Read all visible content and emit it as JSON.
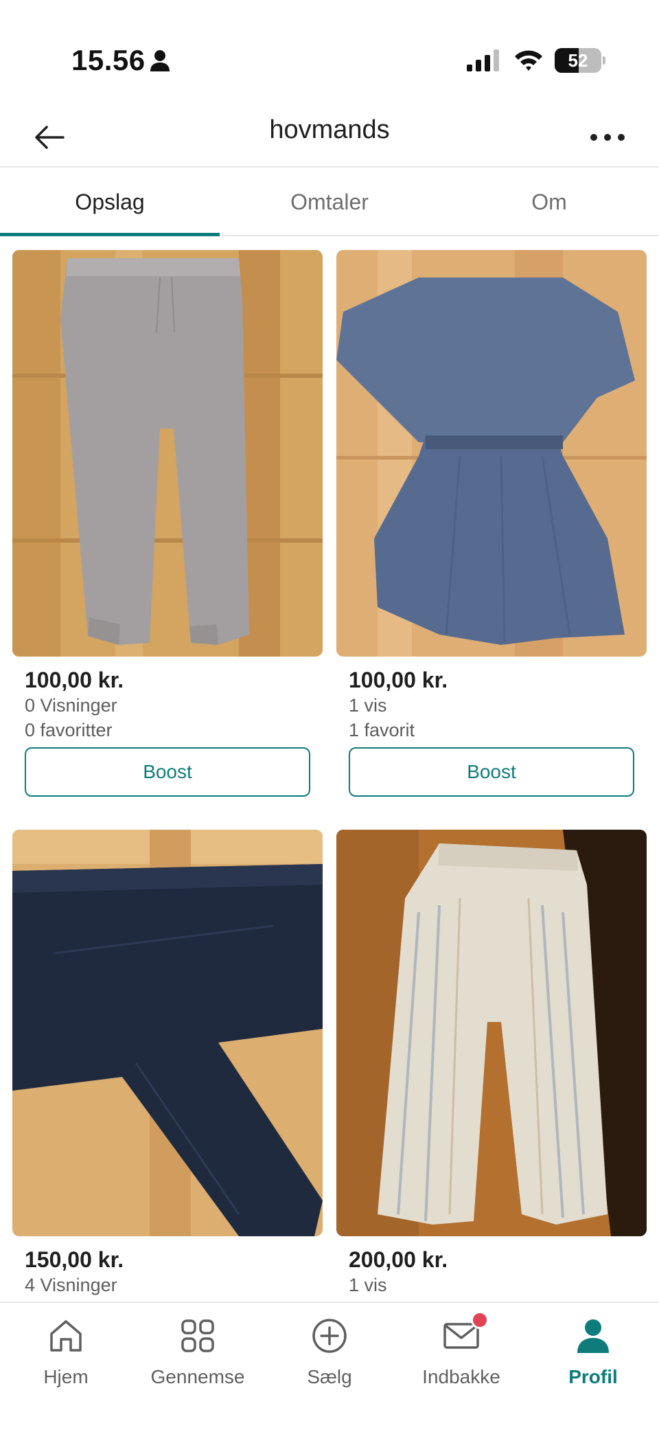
{
  "status_bar": {
    "time": "15.56",
    "battery": "52",
    "battery_level": 0.52
  },
  "header": {
    "title": "hovmands"
  },
  "tabs": [
    {
      "label": "Opslag",
      "active": true
    },
    {
      "label": "Omtaler",
      "active": false
    },
    {
      "label": "Om",
      "active": false
    }
  ],
  "listings": [
    {
      "price": "100,00 kr.",
      "views": "0 Visninger",
      "favorites": "0 favoritter",
      "button": "Boost"
    },
    {
      "price": "100,00 kr.",
      "views": "1 vis",
      "favorites": "1 favorit",
      "button": "Boost"
    },
    {
      "price": "150,00 kr.",
      "views": "4 Visninger",
      "favorites": "",
      "button": ""
    },
    {
      "price": "200,00 kr.",
      "views": "1 vis",
      "favorites": "",
      "button": ""
    }
  ],
  "bottom_nav": [
    {
      "label": "Hjem",
      "icon": "home-icon",
      "active": false
    },
    {
      "label": "Gennemse",
      "icon": "grid-icon",
      "active": false
    },
    {
      "label": "Sælg",
      "icon": "plus-circle-icon",
      "active": false
    },
    {
      "label": "Indbakke",
      "icon": "mail-icon",
      "active": false,
      "badge": true
    },
    {
      "label": "Profil",
      "icon": "person-icon",
      "active": true
    }
  ],
  "colors": {
    "accent": "#0e7c7b",
    "badge": "#e04452",
    "text": "#1f1f1f",
    "muted": "#6e6e6e"
  }
}
